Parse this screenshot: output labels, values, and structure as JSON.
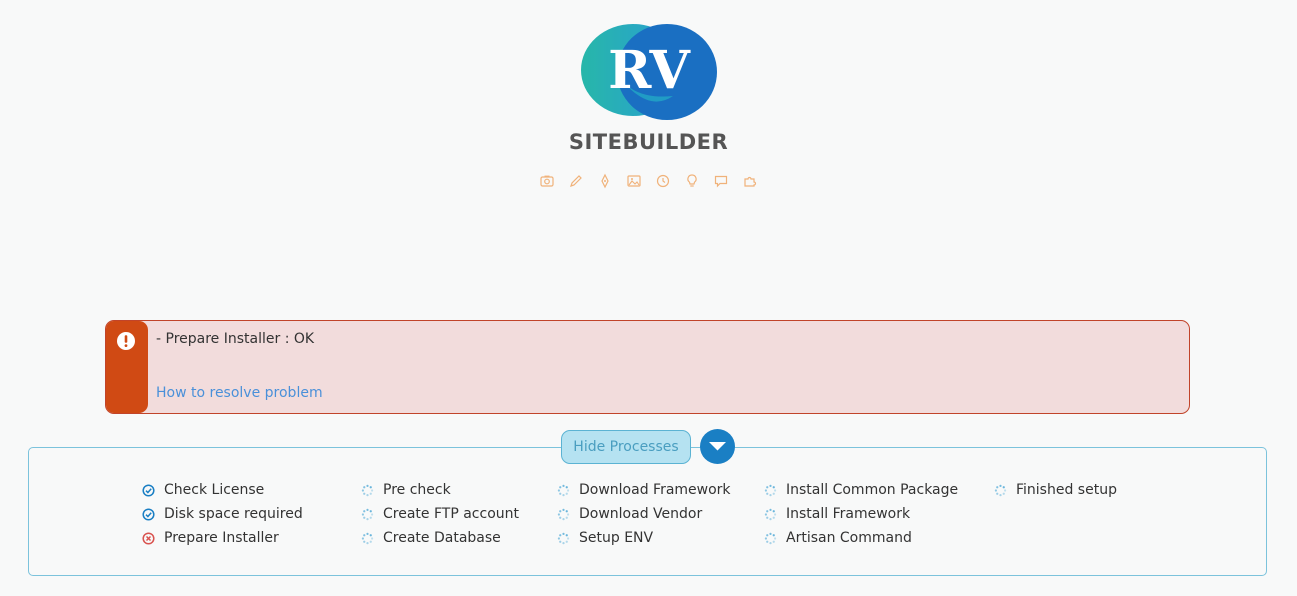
{
  "brand": {
    "name": "SITEBUILDER",
    "logo_letters": "RV",
    "colors": {
      "logo_green": "#27b7a9",
      "logo_blue": "#1a6fc2",
      "accent_orange": "#f0b27a"
    }
  },
  "icon_strip": [
    "camera-icon",
    "pencil-icon",
    "pen-nib-icon",
    "image-icon",
    "clock-icon",
    "lightbulb-icon",
    "chat-icon",
    "puzzle-icon"
  ],
  "alert": {
    "message": "- Prepare Installer : OK",
    "link_text": "How to resolve problem",
    "icon": "exclamation-circle-icon",
    "colors": {
      "border": "#c1442a",
      "side": "#d04a14",
      "background": "#f2dcdc"
    }
  },
  "processes": {
    "toggle_label": "Hide Processes",
    "columns": [
      [
        {
          "label": "Check License",
          "status": "done"
        },
        {
          "label": "Disk space required",
          "status": "done"
        },
        {
          "label": "Prepare Installer",
          "status": "error"
        }
      ],
      [
        {
          "label": "Pre check",
          "status": "pending"
        },
        {
          "label": "Create FTP account",
          "status": "pending"
        },
        {
          "label": "Create Database",
          "status": "pending"
        }
      ],
      [
        {
          "label": "Download Framework",
          "status": "pending"
        },
        {
          "label": "Download Vendor",
          "status": "pending"
        },
        {
          "label": "Setup ENV",
          "status": "pending"
        }
      ],
      [
        {
          "label": "Install Common Package",
          "status": "pending"
        },
        {
          "label": "Install Framework",
          "status": "pending"
        },
        {
          "label": "Artisan Command",
          "status": "pending"
        }
      ],
      [
        {
          "label": "Finished setup",
          "status": "pending"
        }
      ]
    ],
    "status_colors": {
      "done": "#1a7fc4",
      "error": "#d9534f",
      "pending": "#5aaed8"
    }
  }
}
